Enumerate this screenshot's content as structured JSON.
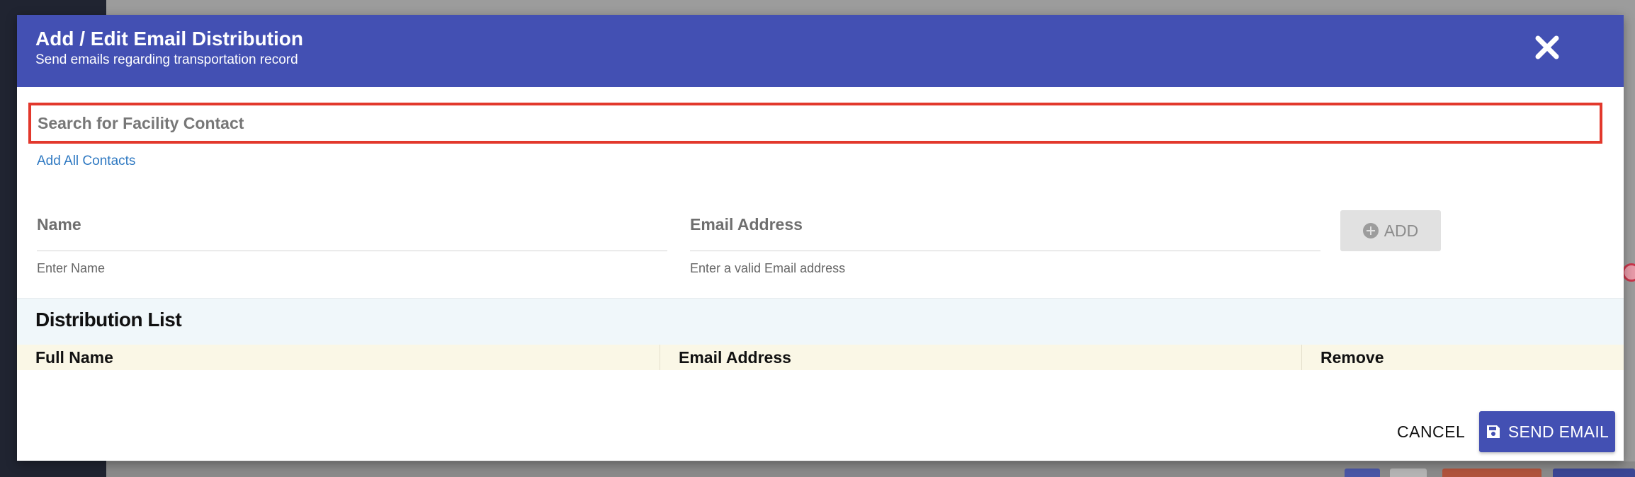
{
  "modal": {
    "title": "Add / Edit Email Distribution",
    "subtitle": "Send emails regarding transportation record"
  },
  "search": {
    "placeholder": "Search for Facility Contact",
    "add_all_label": "Add All Contacts"
  },
  "form": {
    "name_label": "Name",
    "name_helper": "Enter Name",
    "email_label": "Email Address",
    "email_helper": "Enter a valid Email address",
    "add_label": "ADD"
  },
  "distribution": {
    "title": "Distribution List",
    "columns": [
      "Full Name",
      "Email Address",
      "Remove"
    ]
  },
  "footer": {
    "cancel_label": "CANCEL",
    "send_label": "SEND EMAIL"
  },
  "colors": {
    "header_bg": "#4350b3",
    "search_border": "#e2382c",
    "link": "#2f79c2",
    "table_head_bg": "#faf7e6",
    "section_bg": "#f0f7fa"
  },
  "icons": {
    "close": "close-icon",
    "add": "plus-circle-icon",
    "send": "save-icon"
  }
}
